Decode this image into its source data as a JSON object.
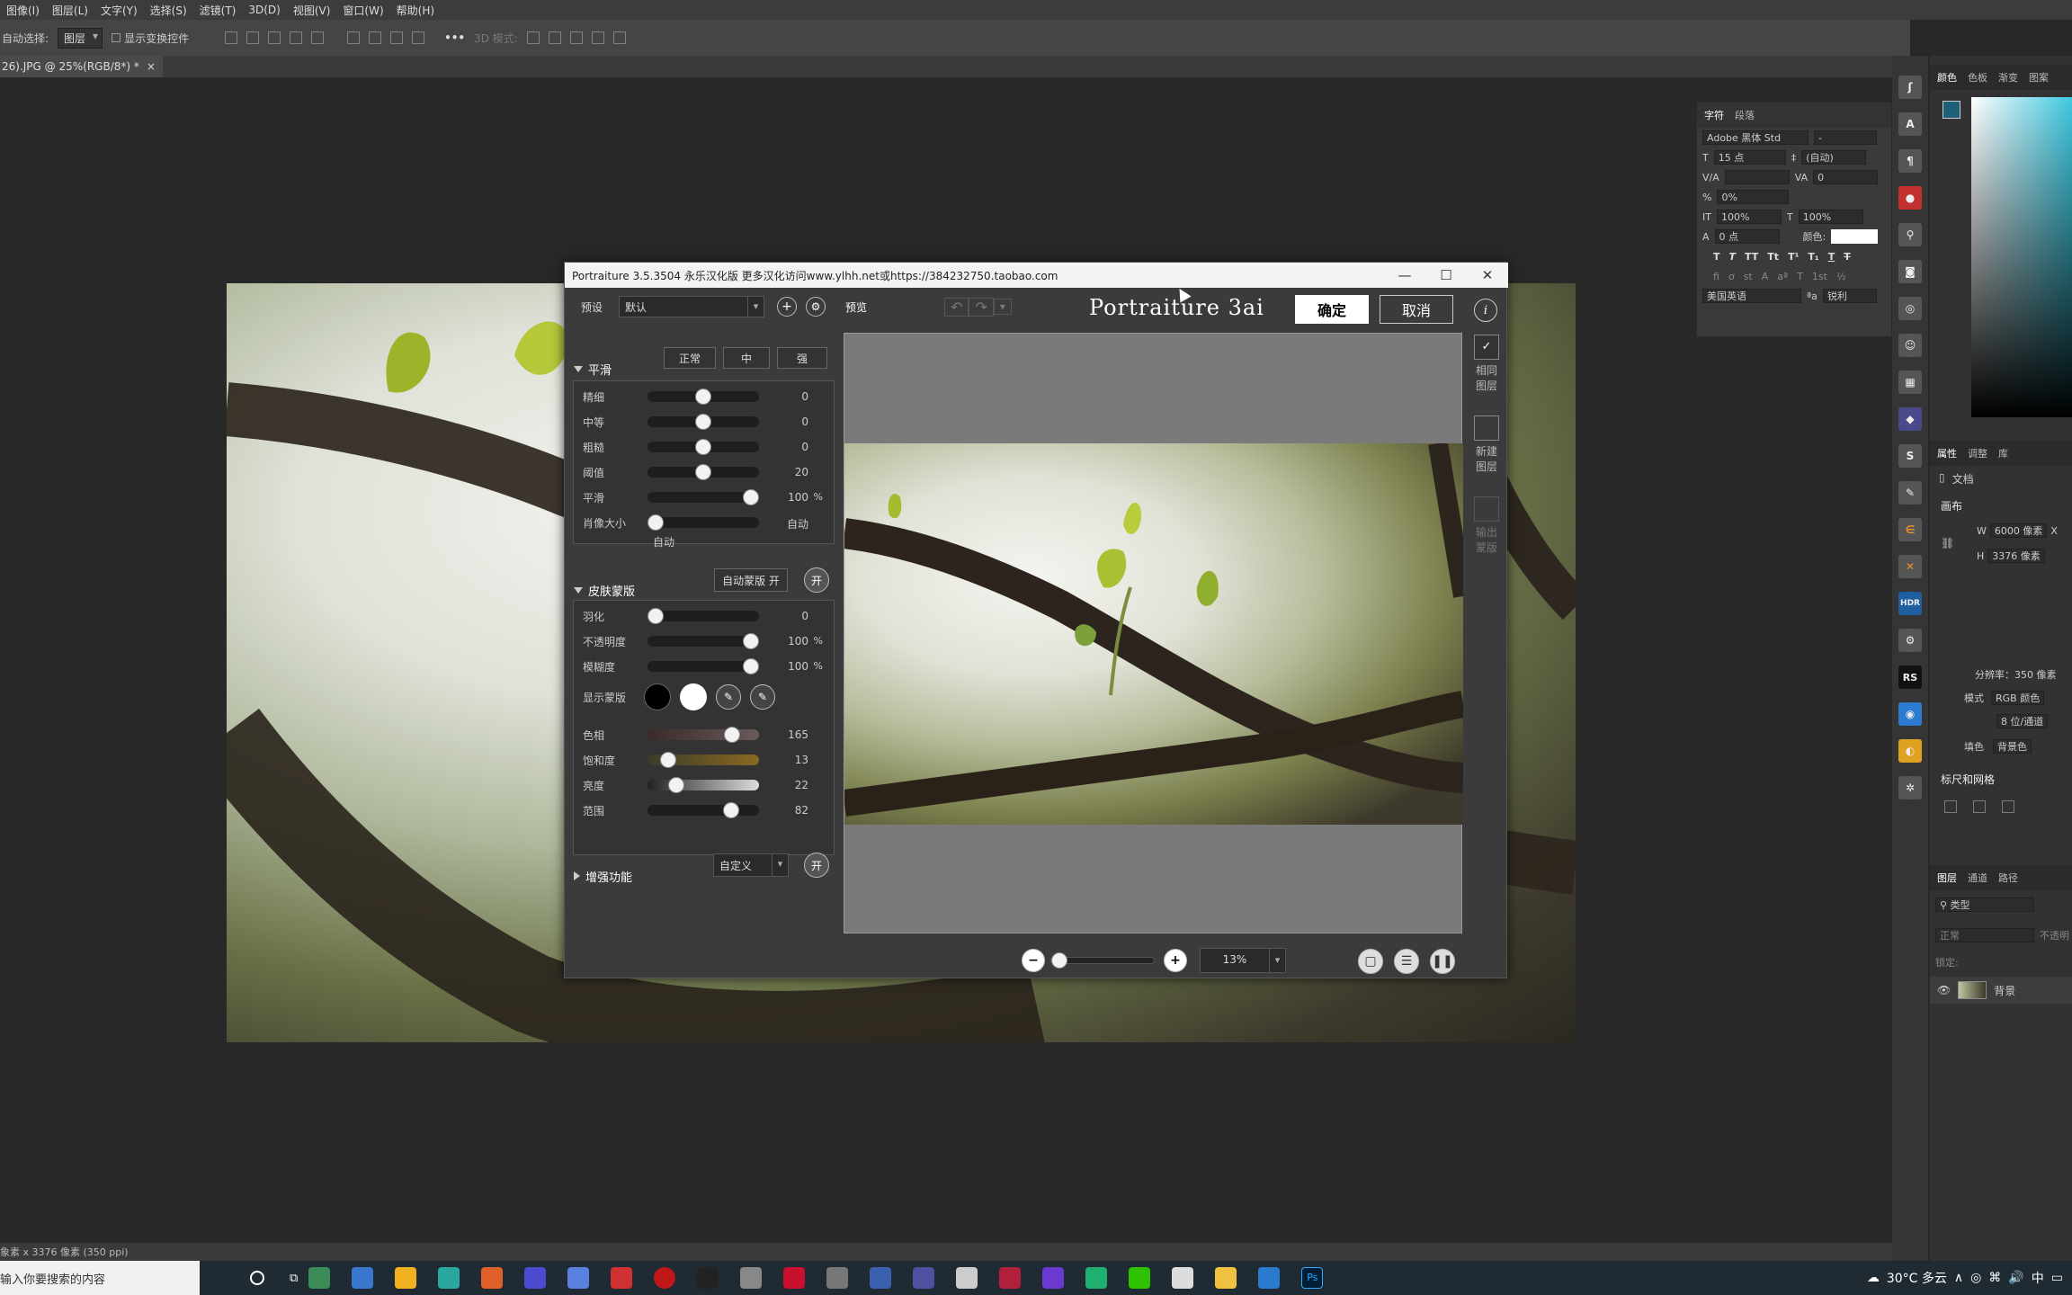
{
  "menubar": {
    "items": [
      "图像(I)",
      "图层(L)",
      "文字(Y)",
      "选择(S)",
      "滤镜(T)",
      "3D(D)",
      "视图(V)",
      "窗口(W)",
      "帮助(H)"
    ]
  },
  "optionsbar": {
    "auto_select_label": "自动选择:",
    "auto_select_value": "图层",
    "show_transform_label": "显示变换控件",
    "mode_3d_label": "3D 模式:"
  },
  "document_tab": {
    "title": "26).JPG @ 25%(RGB/8*) *",
    "close": "×"
  },
  "statusbar": {
    "text": "象素 x 3376 像素 (350 ppi)"
  },
  "taskbar": {
    "search_placeholder": "输入你要搜索的内容",
    "weather": "30°C 多云",
    "ime": "中"
  },
  "char_panel": {
    "tabs": [
      "字符",
      "段落"
    ],
    "font_family": "Adobe 黑体 Std",
    "font_style": "-",
    "size": "15 点",
    "leading": "(自动)",
    "tracking": "0",
    "vscale": "0%",
    "vertical_scale": "100%",
    "horizontal_scale": "100%",
    "baseline": "0 点",
    "color_label": "颜色:",
    "language": "美国英语",
    "aa_value": "锐利",
    "aa_prefix": "ªa"
  },
  "right_panel": {
    "color_tabs": [
      "颜色",
      "色板",
      "渐变",
      "图案"
    ],
    "props_tabs": [
      "属性",
      "调整",
      "库"
    ],
    "doc_label": "文档",
    "canvas_label": "画布",
    "w_label": "W",
    "w_value": "6000 像素",
    "w_suffix": "X",
    "h_label": "H",
    "h_value": "3376 像素",
    "resolution": "分辨率：350 像素",
    "mode_label": "模式",
    "mode_value": "RGB 颜色",
    "depth_value": "8 位/通道",
    "fill_label": "填色",
    "fill_value": "背景色",
    "rulers_label": "标尺和网格",
    "layers_tabs": [
      "图层",
      "通道",
      "路径"
    ],
    "layer_search": "类型",
    "blend_mode": "正常",
    "opacity_label": "不透明",
    "lock_label": "锁定:",
    "layer_name": "背景"
  },
  "toolstrip": {
    "labels": [
      "HDR",
      "RS"
    ]
  },
  "dialog": {
    "title": "Portraiture 3.5.3504 永乐汉化版     更多汉化访问www.ylhh.net或https://384232750.taobao.com",
    "controls": [
      "—",
      "☐",
      "✕"
    ],
    "preset_label": "预设",
    "preset_value": "默认",
    "plus_glyph": "+",
    "gear_glyph": "⚙",
    "preview_label": "预览",
    "logo": "Portraiture 3ai",
    "ok": "确定",
    "cancel": "取消",
    "info": "i",
    "smooth": {
      "title": "平滑",
      "buttons": [
        "正常",
        "中",
        "强"
      ],
      "sliders": [
        {
          "label": "精细",
          "value": "0",
          "unit": "",
          "level": 0.5
        },
        {
          "label": "中等",
          "value": "0",
          "unit": "",
          "level": 0.5
        },
        {
          "label": "粗糙",
          "value": "0",
          "unit": "",
          "level": 0.5
        },
        {
          "label": "阈值",
          "value": "20",
          "unit": "",
          "level": 0.5
        },
        {
          "label": "平滑",
          "value": "100",
          "unit": "%",
          "level": 1.0
        },
        {
          "label": "肖像大小",
          "value": "自动",
          "unit": "",
          "level": 0.0
        }
      ],
      "auto_note": "自动"
    },
    "skin": {
      "title": "皮肤蒙版",
      "auto_mask_btn": "自动蒙版 开",
      "toggle": "开",
      "sliders": [
        {
          "label": "羽化",
          "value": "0",
          "unit": "",
          "level": 0.0
        },
        {
          "label": "不透明度",
          "value": "100",
          "unit": "%",
          "level": 1.0
        },
        {
          "label": "模糊度",
          "value": "100",
          "unit": "%",
          "level": 1.0
        }
      ],
      "show_mask_label": "显示蒙版",
      "hue_sliders": [
        {
          "label": "色相",
          "value": "165",
          "unit": "",
          "level": 0.8
        },
        {
          "label": "饱和度",
          "value": "13",
          "unit": "",
          "level": 0.13
        },
        {
          "label": "亮度",
          "value": "22",
          "unit": "",
          "level": 0.22
        },
        {
          "label": "范围",
          "value": "82",
          "unit": "",
          "level": 0.79
        }
      ]
    },
    "enhance": {
      "title": "增强功能",
      "dropdown": "自定义",
      "toggle": "开"
    },
    "side": {
      "same_layer": "相同\n图层",
      "new_layer": "新建\n图层",
      "output_mask": "输出\n蒙版",
      "check_glyph": "✓"
    },
    "zoom": {
      "value": "13%",
      "minus": "−",
      "plus": "+",
      "level": 0.0
    }
  }
}
